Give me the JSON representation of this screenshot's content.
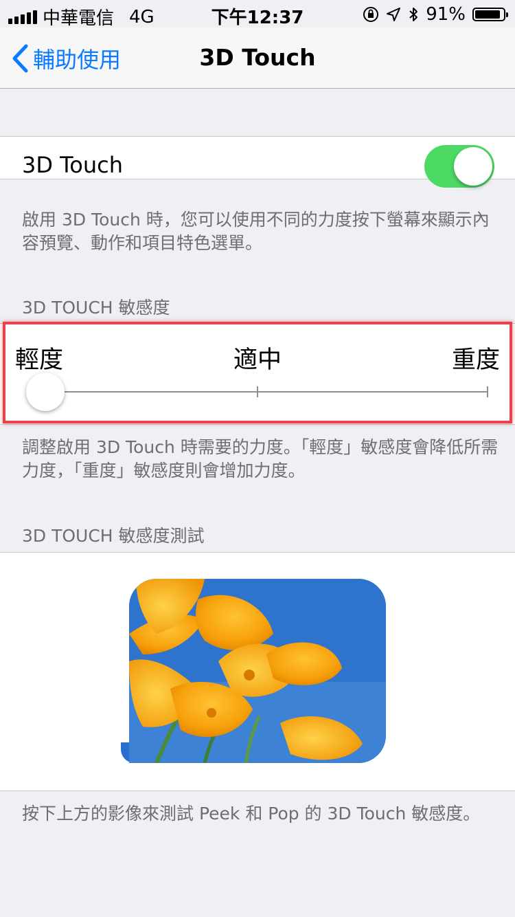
{
  "status_bar": {
    "carrier": "中華電信",
    "network": "4G",
    "time": "下午12:37",
    "battery": "91%",
    "battery_level": 0.91
  },
  "nav": {
    "back_label": "輔助使用",
    "title": "3D Touch"
  },
  "toggle": {
    "label": "3D Touch",
    "on": true,
    "color": "#4cd964"
  },
  "toggle_footer": "啟用 3D Touch 時，您可以使用不同的力度按下螢幕來顯示內容預覽、動作和項目特色選單。",
  "sensitivity": {
    "header": "3D TOUCH 敏感度",
    "labels": [
      "輕度",
      "適中",
      "重度"
    ],
    "selected": "輕度",
    "footer": "調整啟用 3D Touch 時需要的力度。「輕度」敏感度會降低所需力度，「重度」敏感度則會增加力度。"
  },
  "test": {
    "header": "3D TOUCH 敏感度測試",
    "footer": "按下上方的影像來測試 Peek 和 Pop 的 3D Touch 敏感度。"
  },
  "colors": {
    "accent": "#0a7aff",
    "highlight": "#e8434c",
    "background": "#efeff4"
  }
}
